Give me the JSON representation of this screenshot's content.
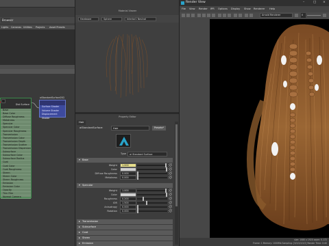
{
  "hypershade": {
    "left_tab": "Browser",
    "lists": [
      "Lights",
      "Cameras",
      "Utilities",
      "Projects",
      "Asset Presets"
    ],
    "material_node": {
      "title": "Dist Surface",
      "attributes": [
        "Base",
        "Base Color",
        "Diffuse Roughness",
        "Metalness",
        "Specular",
        "Specular Color",
        "Specular Roughness",
        "Transmission",
        "Transmission Color",
        "Transmission Depth",
        "Transmission Scatter",
        "Transmission Dispersion",
        "Subsurface",
        "Subsurface Color",
        "Subsurface Radius",
        "Coat",
        "Coat Color",
        "Coat Roughness",
        "Sheen",
        "Sheen Color",
        "Sheen Roughness",
        "Emission",
        "Emission Color",
        "Opacity",
        "Thin Film",
        "Normal Camera"
      ]
    },
    "shading_group": {
      "title": "aiStandardSurface2SG",
      "attributes": [
        "Surface Shader",
        "Volume Shader",
        "Displacement Shader"
      ]
    }
  },
  "material_viewer": {
    "title": "Material Viewer",
    "renderer": "Hardware",
    "geometry": "Sphere",
    "environment": "Interior1 Neutral"
  },
  "property_editor": {
    "title": "Property Editor",
    "tab": "Hair",
    "node_type_label": "aiStandardSurface:",
    "name": "Hair",
    "presets_button": "Presets*",
    "type_label": "Type",
    "type_value": "ai Standard Surface",
    "sections": {
      "base": "Base",
      "specular": "Specular",
      "transmission": "Transmission",
      "subsurface": "Subsurface",
      "coat": "Coat",
      "sheen": "Sheen",
      "emission": "Emission"
    },
    "base_rows": [
      {
        "label": "Weight",
        "value": "1.000",
        "fill": 0.98,
        "highlight": true
      },
      {
        "label": "Color",
        "swatch": "#d0d0d0"
      },
      {
        "label": "Diffuse Roughness",
        "value": "0.000",
        "fill": 0.0
      },
      {
        "label": "Metalness",
        "value": "0.000",
        "fill": 0.0
      }
    ],
    "specular_rows": [
      {
        "label": "Weight",
        "value": "1.000",
        "fill": 0.98
      },
      {
        "label": "Color",
        "swatch": "#d0d0d0"
      },
      {
        "label": "Roughness",
        "value": "0.200",
        "fill": 0.2
      },
      {
        "label": "IOR",
        "value": "1.500",
        "fill": 0.3
      },
      {
        "label": "Anisotropy",
        "value": "0.000",
        "fill": 0.0
      },
      {
        "label": "Rotation",
        "value": "0.000",
        "fill": 0.0
      }
    ]
  },
  "render_view": {
    "title": "Render View",
    "menu": [
      "File",
      "View",
      "Render",
      "IPR",
      "Options",
      "Display",
      "Show",
      "Renderer",
      "Help"
    ],
    "renderer": "Arnold Renderer",
    "frame_value": "0",
    "status_line1": "size: 1080 x 1920 zoom: 0.172",
    "status_line2": "Frame: 1   Memory: 1000Mb   Sampling: [3/2/2/2/2/2]   Render Time: 0:40"
  },
  "colors": {
    "viewport_bg": "#000000",
    "hair": "#8b5a2b",
    "node_green": "#6e8a6e",
    "node_blue": "#3d4a9e",
    "highlight_field": "#e6de8a"
  }
}
